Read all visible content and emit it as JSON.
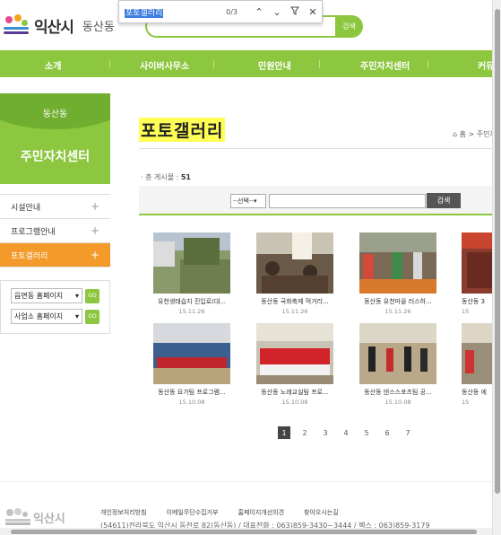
{
  "header": {
    "city": "익산시",
    "dong": "동산동",
    "search_button": "검색"
  },
  "findbar": {
    "query": "포토갤러리",
    "count": "0/3",
    "up_icon": "chevron-up-icon",
    "down_icon": "chevron-down-icon",
    "filter_icon": "filter-icon",
    "close_icon": "close-icon"
  },
  "nav": [
    "소개",
    "사이버사무소",
    "민원안내",
    "주민자치센터",
    "커뮤"
  ],
  "sidebar": {
    "subtitle": "동산동",
    "title": "주민자치센터",
    "items": [
      {
        "label": "시설안내",
        "active": false
      },
      {
        "label": "프로그램안내",
        "active": false
      },
      {
        "label": "포토갤러리",
        "active": true
      }
    ],
    "selects": [
      {
        "label": "읍면동 홈페이지",
        "go": "GO"
      },
      {
        "label": "사업소 홈페이지",
        "go": "GO"
      }
    ]
  },
  "main": {
    "title": "포토갤러리",
    "breadcrumb": "홈 > 주민자",
    "total_label": "· 총 게시물 : ",
    "total_count": "51",
    "filter_select": "--선택--",
    "search_button": "검색"
  },
  "gallery": [
    {
      "caption": "유천생태습지 진입로(대...",
      "date": "15.11.26"
    },
    {
      "caption": "동산동 국화축제 먹거리...",
      "date": "15.11.26"
    },
    {
      "caption": "동산동 유천마을 러스하...",
      "date": "15.11.26"
    },
    {
      "caption": "동산동 3",
      "date": "15"
    },
    {
      "caption": "동산동 요가팀 프로그램...",
      "date": "15.10.08"
    },
    {
      "caption": "동산동 노래교실팀 프로...",
      "date": "15.10.08"
    },
    {
      "caption": "동산동 댄스스포츠팀 공...",
      "date": "15.10.08"
    },
    {
      "caption": "동산동 에",
      "date": "15"
    }
  ],
  "pager": [
    "1",
    "2",
    "3",
    "4",
    "5",
    "6",
    "7"
  ],
  "footer": {
    "links": [
      "개인정보처리방침",
      "이메일무단수집거부",
      "홈페이지개선의견",
      "찾아오시는길"
    ],
    "address": "(54611)전라북도 익산시 동천로 82(동산동) / 대표전화 : 063)859-3430~3444 / 팩스 : 063)859-3179",
    "logo_text": "익산시"
  },
  "colors": {
    "accent": "#8dc63f",
    "active": "#f39a2a",
    "highlight": "#ffff55"
  }
}
